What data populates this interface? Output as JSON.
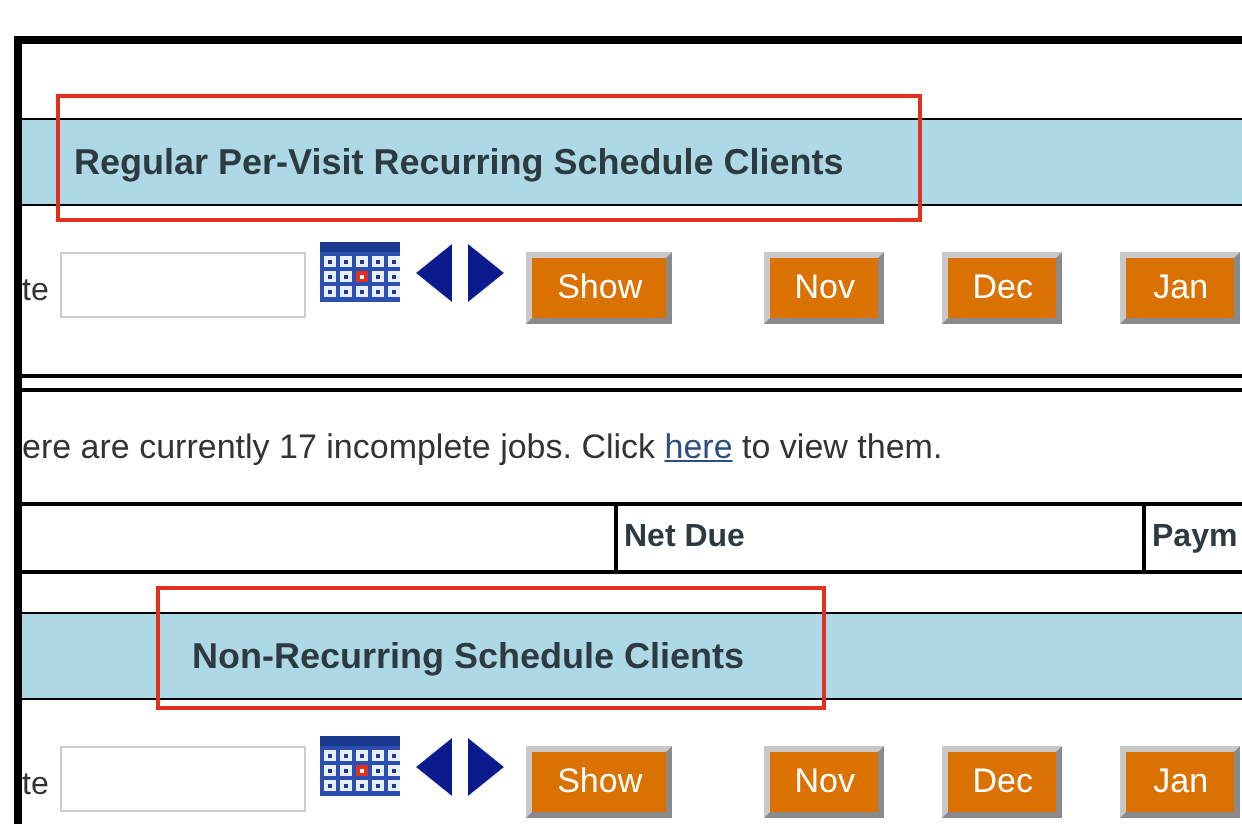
{
  "sections": [
    {
      "title": "Regular Per-Visit Recurring Schedule Clients",
      "highlighted": true,
      "date_label": "te",
      "buttons": [
        "Show",
        "Nov",
        "Dec",
        "Jan"
      ]
    },
    {
      "title": "Non-Recurring Schedule Clients",
      "highlighted": true,
      "date_label": "te",
      "buttons": [
        "Show",
        "Nov",
        "Dec",
        "Jan"
      ]
    }
  ],
  "notice": {
    "before": "ere are currently 17 incomplete jobs. Click",
    "link": "here",
    "after": "to view them."
  },
  "table": {
    "columns": [
      {
        "label": "Net Due"
      },
      {
        "label": "Paym"
      }
    ]
  }
}
